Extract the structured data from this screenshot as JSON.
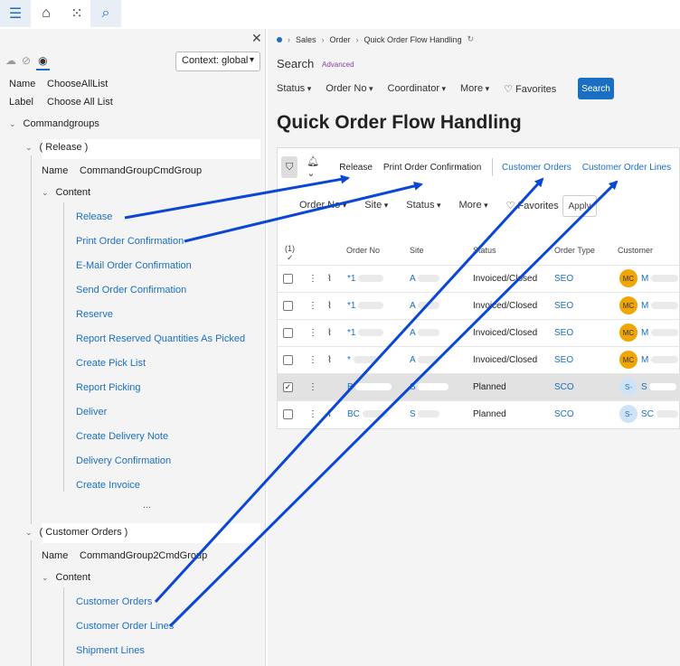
{
  "breadcrumb": [
    "Sales",
    "Order",
    "Quick Order Flow Handling"
  ],
  "search": {
    "label": "Search",
    "advanced": "Advanced",
    "button": "Search"
  },
  "top_filters": [
    "Status",
    "Order No",
    "Coordinator",
    "More",
    "Favorites"
  ],
  "page_title": "Quick Order Flow Handling",
  "left_panel": {
    "context": "Context: global",
    "name_label": "Name",
    "name_value": "ChooseAllList",
    "label_label": "Label",
    "label_value": "Choose All List",
    "root": "Commandgroups",
    "group1": {
      "title": "( Release )",
      "name_label": "Name",
      "name_value": "CommandGroupCmdGroup",
      "content": "Content",
      "items": [
        "Release",
        "Print Order Confirmation",
        "E-Mail Order Confirmation",
        "Send Order Confirmation",
        "Reserve",
        "Report Reserved Quantities As Picked",
        "Create Pick List",
        "Report Picking",
        "Deliver",
        "Create Delivery Note",
        "Delivery Confirmation",
        "Create Invoice"
      ],
      "more": "..."
    },
    "group2": {
      "title": "( Customer Orders )",
      "name_label": "Name",
      "name_value": "CommandGroup2CmdGroup",
      "content": "Content",
      "items": [
        "Customer Orders",
        "Customer Order Lines",
        "Shipment Lines"
      ]
    }
  },
  "commands": [
    "Release",
    "Print Order Confirmation",
    "Customer Orders",
    "Customer Order Lines"
  ],
  "sub_filters": [
    "Order No",
    "Site",
    "Status",
    "More",
    "Favorites"
  ],
  "apply": "Apply",
  "table": {
    "count": "(1)",
    "columns": [
      "Order No",
      "Site",
      "Status",
      "Order Type",
      "Customer"
    ],
    "rows": [
      {
        "order_no": "*1",
        "site": "A",
        "status": "Invoiced/Closed",
        "type": "SEO",
        "avatar": "MC",
        "customer": "M",
        "selected": false
      },
      {
        "order_no": "*1",
        "site": "A",
        "status": "Invoiced/Closed",
        "type": "SEO",
        "avatar": "MC",
        "customer": "M",
        "selected": false
      },
      {
        "order_no": "*1",
        "site": "A",
        "status": "Invoiced/Closed",
        "type": "SEO",
        "avatar": "MC",
        "customer": "M",
        "selected": false
      },
      {
        "order_no": "*",
        "site": "A",
        "status": "Invoiced/Closed",
        "type": "SEO",
        "avatar": "MC",
        "customer": "M",
        "selected": false
      },
      {
        "order_no": "B",
        "site": "S",
        "status": "Planned",
        "type": "SCO",
        "avatar": "S-",
        "customer": "S",
        "selected": true
      },
      {
        "order_no": "BC",
        "site": "S",
        "status": "Planned",
        "type": "SCO",
        "avatar": "S-",
        "customer": "SC",
        "selected": false
      }
    ]
  },
  "colors": {
    "accent": "#1a6fc4",
    "arrow": "#0b47d6",
    "avatar_mc": "#f0a500"
  }
}
